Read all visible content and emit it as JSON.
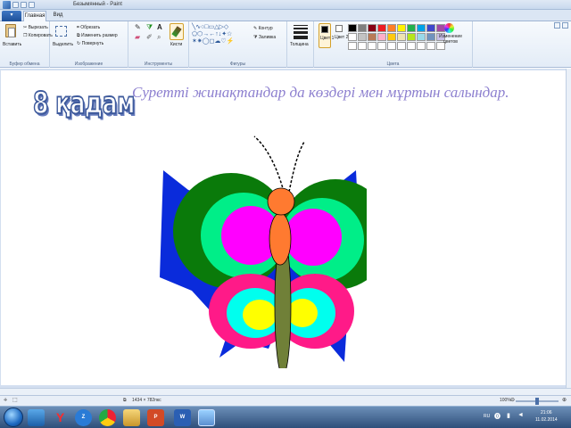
{
  "window": {
    "title": "Безымянный - Paint"
  },
  "ribbon_tabs": [
    {
      "label": "Главная"
    },
    {
      "label": "Вид"
    }
  ],
  "clipboard": {
    "paste": "Вставить",
    "cut": "Вырезать",
    "copy": "Копировать",
    "group": "Буфер обмена"
  },
  "image": {
    "select": "Выделить",
    "crop": "Обрезать",
    "resize": "Изменить размер",
    "rotate": "Повернуть",
    "group": "Изображение"
  },
  "tools": {
    "brushes": "Кисти",
    "group": "Инструменты"
  },
  "shapes": {
    "outline": "Контур",
    "fill": "Заливка",
    "group": "Фигуры"
  },
  "size": {
    "label": "Толщина"
  },
  "colors": {
    "color1": "Цвет 1",
    "color2": "Цвет 2",
    "edit": "Изменение цветов",
    "group": "Цвета",
    "palette": [
      "#000000",
      "#7f7f7f",
      "#880015",
      "#ed1c24",
      "#ff7f27",
      "#fff200",
      "#22b14c",
      "#00a2e8",
      "#3f48cc",
      "#a349a4",
      "#ffffff",
      "#c3c3c3",
      "#b97a57",
      "#ffaec9",
      "#ffc90e",
      "#efe4b0",
      "#b5e61d",
      "#99d9ea",
      "#7092be",
      "#c8bfe7",
      "#ffffff",
      "#ffffff",
      "#ffffff",
      "#ffffff",
      "#ffffff",
      "#ffffff",
      "#ffffff",
      "#ffffff",
      "#ffffff",
      "#ffffff"
    ]
  },
  "canvas": {
    "step_title": "8 қадам",
    "caption": "Суретті жинақтандар да көздері мен мұртын салындар.",
    "butterfly_colors": {
      "outer_wing": "#0a2bdb",
      "ring_green": "#0a7a0a",
      "ring_mint": "#00ee88",
      "ring_magenta": "#ff00ff",
      "lower_pink": "#ff1a88",
      "lower_cyan": "#00ffee",
      "lower_yellow": "#ffff00",
      "body": "#708038",
      "head": "#ff7a30"
    }
  },
  "status": {
    "dimensions": "1434 × 782пкс",
    "zoom": "100%"
  },
  "taskbar": {
    "language": "RU",
    "time": "21:06",
    "date": "11.02.2014"
  }
}
